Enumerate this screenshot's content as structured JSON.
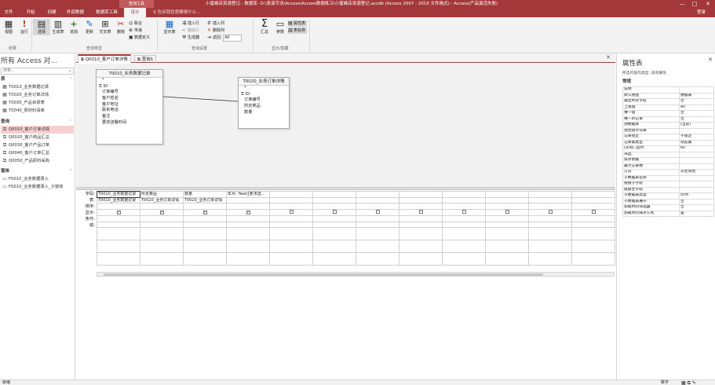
{
  "titlebar": {
    "context_label": "查询工具",
    "title": "小蜜蜂店资源登记 : 数据库- D:\\表演手法\\Access\\Access数据练习\\小蜜蜂店资源登记.accdb (Access 2007 - 2016 文件格式) - Access(产品激活失败)",
    "min": "—",
    "max": "□",
    "close": "✕"
  },
  "tabs": [
    "文件",
    "开始",
    "创建",
    "外部数据",
    "数据库工具",
    "帮助",
    "设计"
  ],
  "active_tab": "设计",
  "tell_me": "告诉我您想要做什么...",
  "sign_in": "登录",
  "ribbon": {
    "results": {
      "view": "视图",
      "run": "运行",
      "group": "结果"
    },
    "query_type": {
      "select": "选择",
      "make_table": "生成表",
      "append": "追加",
      "update": "更新",
      "crosstab": "交叉表",
      "delete": "删除",
      "union": "联合",
      "passthrough": "传递",
      "data_definition": "数据定义",
      "group": "查询类型"
    },
    "query_setup": {
      "show_table": "显示表",
      "insert_rows": "插入行",
      "delete_rows": "删除行",
      "builder": "生成器",
      "insert_columns": "插入列",
      "delete_columns": "删除列",
      "return_label": "返回:",
      "return_value": "All",
      "group": "查询设置"
    },
    "show_hide": {
      "totals": "汇总",
      "parameters": "参数",
      "property_sheet": "属性表",
      "table_names": "表名称",
      "group": "显示/隐藏"
    }
  },
  "nav": {
    "header": "所有 Access 对...",
    "search_placeholder": "搜索...",
    "sections": [
      {
        "label": "表",
        "items": [
          "T0010_业务数据记录",
          "T0020_业务订单详情",
          "T0030_产品目录表",
          "T0040_原材料清单"
        ]
      },
      {
        "label": "查询",
        "items": [
          "Q0010_客户订单详情",
          "Q0020_客户商品汇总",
          "Q0030_客户产品订单",
          "Q0040_客户订单汇总",
          "Q0050_产品原料采购"
        ]
      },
      {
        "label": "窗体",
        "items": [
          "F0010_业务数据录入",
          "F0010_业务数据录入_子窗体"
        ]
      }
    ],
    "selected": "Q0010_客户订单详情"
  },
  "doc_tabs": [
    "Q0010_客户订单详情",
    "查询1"
  ],
  "active_doc": "Q0010_客户订单详情",
  "tables": [
    {
      "name": "T0010_业务数据记录",
      "fields": [
        "*",
        "ID",
        "订单编号",
        "客户姓名",
        "客户地址",
        "联系电话",
        "备注",
        "要求送餐时间"
      ],
      "key": "ID"
    },
    {
      "name": "T0020_业务订单详情",
      "fields": [
        "*",
        "ID",
        "订单编号",
        "所定菜品",
        "数量"
      ],
      "key": "ID"
    }
  ],
  "grid": {
    "row_labels": [
      "字段:",
      "表:",
      "排序:",
      "显示:",
      "条件:",
      "或:"
    ],
    "columns": [
      {
        "field": "T0010_业务数据记录",
        "table": "T0010_业务数据记录",
        "sort": "",
        "show": true
      },
      {
        "field": "所定菜品",
        "table": "T0020_业务订单详情",
        "sort": "",
        "show": true
      },
      {
        "field": "数量",
        "table": "T0020_业务订单详情",
        "sort": "",
        "show": true
      },
      {
        "field": "年月: Year([要求送...",
        "table": "",
        "sort": "",
        "show": true
      },
      {
        "field": "",
        "table": "",
        "sort": "",
        "show": false
      },
      {
        "field": "",
        "table": "",
        "sort": "",
        "show": false
      },
      {
        "field": "",
        "table": "",
        "sort": "",
        "show": false
      },
      {
        "field": "",
        "table": "",
        "sort": "",
        "show": false
      },
      {
        "field": "",
        "table": "",
        "sort": "",
        "show": false
      },
      {
        "field": "",
        "table": "",
        "sort": "",
        "show": false
      },
      {
        "field": "",
        "table": "",
        "sort": "",
        "show": false
      },
      {
        "field": "",
        "table": "",
        "sort": "",
        "show": false
      }
    ]
  },
  "props": {
    "title": "属性表",
    "close": "✕",
    "selection_type": "所选内容的类型: 查询属性",
    "tab": "常规",
    "rows": [
      [
        "说明",
        ""
      ],
      [
        "默认视图",
        "数据表"
      ],
      [
        "输出所有字段",
        "否"
      ],
      [
        "上限值",
        "All"
      ],
      [
        "唯一值",
        "否"
      ],
      [
        "唯一的记录",
        "否"
      ],
      [
        "源数据库",
        "(当前)"
      ],
      [
        "源连接字符串",
        ""
      ],
      [
        "记录锁定",
        "不锁定"
      ],
      [
        "记录集类型",
        "动态集"
      ],
      [
        "ODBC 超时",
        "60"
      ],
      [
        "筛选",
        ""
      ],
      [
        "排序依据",
        ""
      ],
      [
        "最大记录数",
        ""
      ],
      [
        "方向",
        "从左到右"
      ],
      [
        "子数据表名称",
        ""
      ],
      [
        "链接子字段",
        ""
      ],
      [
        "链接主字段",
        ""
      ],
      [
        "子数据表高度",
        "0cm"
      ],
      [
        "子数据表展开",
        "否"
      ],
      [
        "加载时的筛选器",
        "否"
      ],
      [
        "加载时的排序方式",
        "是"
      ]
    ]
  },
  "status": {
    "left": "就绪",
    "right": "数字"
  }
}
